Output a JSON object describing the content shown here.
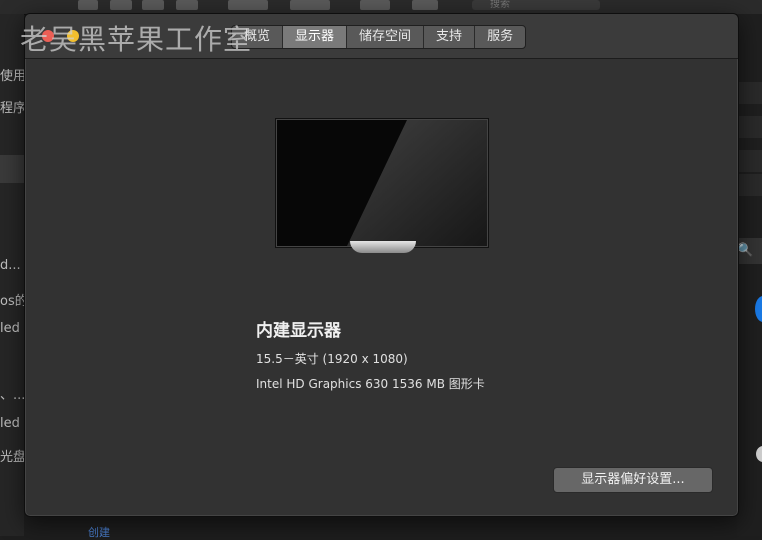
{
  "watermark": {
    "text": "老吴黑苹果工作室"
  },
  "background": {
    "search_placeholder": "搜索",
    "sidebar_texts": [
      "使用",
      "程序",
      "d...",
      "os的",
      "led",
      "、...",
      "led",
      "光盘"
    ],
    "bottom_link": "创建"
  },
  "dialog": {
    "tabs": [
      {
        "label": "概览",
        "active": false
      },
      {
        "label": "显示器",
        "active": true
      },
      {
        "label": "储存空间",
        "active": false
      },
      {
        "label": "支持",
        "active": false
      },
      {
        "label": "服务",
        "active": false
      }
    ],
    "display_name": "内建显示器",
    "size_resolution": "15.5－英寸 (1920 x 1080)",
    "graphics": "Intel HD Graphics 630 1536 MB 图形卡",
    "preferences_button": "显示器偏好设置...",
    "colors": {
      "close": "#ec5f56",
      "minimize": "#f3bf2e"
    }
  }
}
